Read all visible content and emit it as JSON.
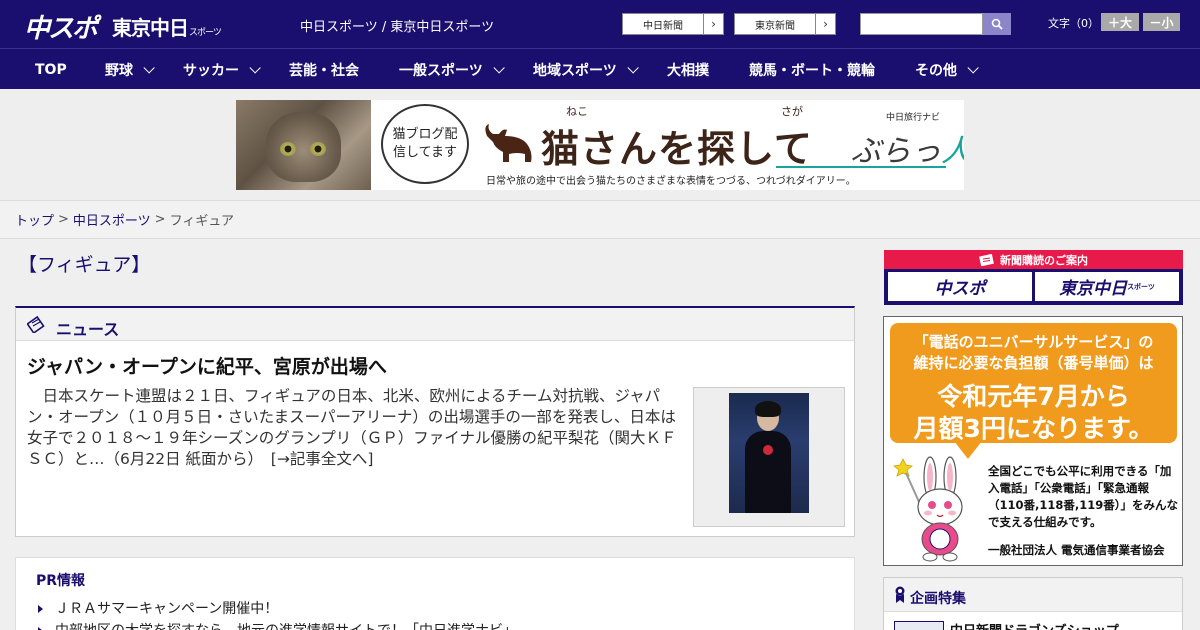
{
  "header": {
    "logo_chuspo": "中スポ",
    "logo_tokyo": "東京中日",
    "logo_tokyo_small": "スポーツ",
    "site_caption": "中日スポーツ / 東京中日スポーツ",
    "paper_links": [
      "中日新聞",
      "東京新聞"
    ],
    "font_size_label": "文字（0）",
    "font_bigger": "＋大",
    "font_smaller": "－小"
  },
  "nav": {
    "items": [
      "TOP",
      "野球",
      "サッカー",
      "芸能・社会",
      "一般スポーツ",
      "地域スポーツ",
      "大相撲",
      "競馬・ボート・競輪",
      "その他"
    ]
  },
  "banner": {
    "bubble_text": "猫ブログ配信してます",
    "ruby1": "ねこ",
    "ruby2": "さが",
    "title": "猫さんを探して",
    "subtitle": "日常や旅の途中で出会う猫たちのさまざまな表情をつづる、つれづれダイアリー。",
    "navi_small": "中日旅行ナビ",
    "navi_main": "ぶらっ",
    "navi_accent": "人"
  },
  "breadcrumb": {
    "items": [
      "トップ",
      "中日スポーツ"
    ],
    "current": "フィギュア",
    "separator": ">"
  },
  "page": {
    "heading": "【フィギュア】"
  },
  "news": {
    "section_title": "ニュース",
    "article_title": "ジャパン・オープンに紀平、宮原が出場へ",
    "article_body": "日本スケート連盟は２１日、フィギュアの日本、北米、欧州によるチーム対抗戦、ジャパン・オープン（１０月５日・さいたまスーパーアリーナ）の出場選手の一部を発表し、日本は女子で２０１８～１９年シーズンのグランプリ（ＧＰ）ファイナル優勝の紀平梨花（関大ＫＦＳＣ）と…（6月22日 紙面から）",
    "read_more": "[→記事全文へ]"
  },
  "pr": {
    "title": "PR情報",
    "items": [
      "ＪＲＡサマーキャンペーン開催中！",
      "中部地区の大学を探すなら、地元の進学情報サイトで！「中日進学ナビ」"
    ]
  },
  "sidebar": {
    "subscribe_head": "新聞購読のご案内",
    "subscribe_btn1": "中スポ",
    "subscribe_btn2": "東京中日",
    "subscribe_btn2_small": "スポーツ",
    "ad_lines": [
      "「電話のユニバーサルサービス」の",
      "維持に必要な負担額（番号単価）は",
      "令和元年7月から",
      "月額3円になります。"
    ],
    "ad_text": "全国どこでも公平に利用できる「加入電話」「公衆電話」「緊急通報（110番,118番,119番）」をみんなで支える仕組みです。",
    "ad_org": "一般社団法人 電気通信事業者協会",
    "kikaku_title": "企画特集",
    "kikaku_item": "中日新聞ドラゴンズショップ"
  },
  "colors": {
    "brand_navy": "#1a0f6e",
    "accent_red": "#e81a4a",
    "ad_orange": "#f19b1e"
  }
}
